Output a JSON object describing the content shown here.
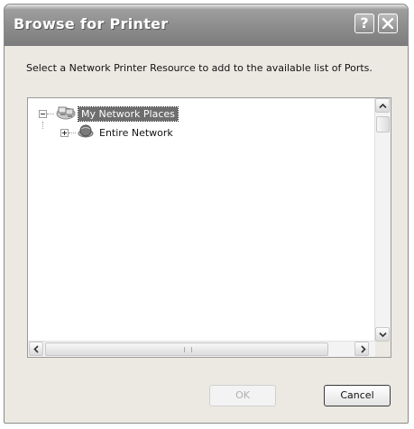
{
  "window": {
    "title": "Browse for Printer",
    "help_button": "?",
    "close_button": "close"
  },
  "instructions": "Select a Network Printer Resource to add to the available list of Ports.",
  "tree": {
    "items": [
      {
        "label": "My Network Places",
        "expanded": true,
        "selected": true,
        "icon": "network-places-icon"
      },
      {
        "label": "Entire Network",
        "expanded": false,
        "selected": false,
        "icon": "globe-icon"
      }
    ]
  },
  "buttons": {
    "ok": "OK",
    "cancel": "Cancel",
    "ok_enabled": false
  },
  "colors": {
    "titlebar": "#8c8c8c",
    "selection": "#6e6e6e",
    "dialog_bg": "#ece9e3"
  }
}
